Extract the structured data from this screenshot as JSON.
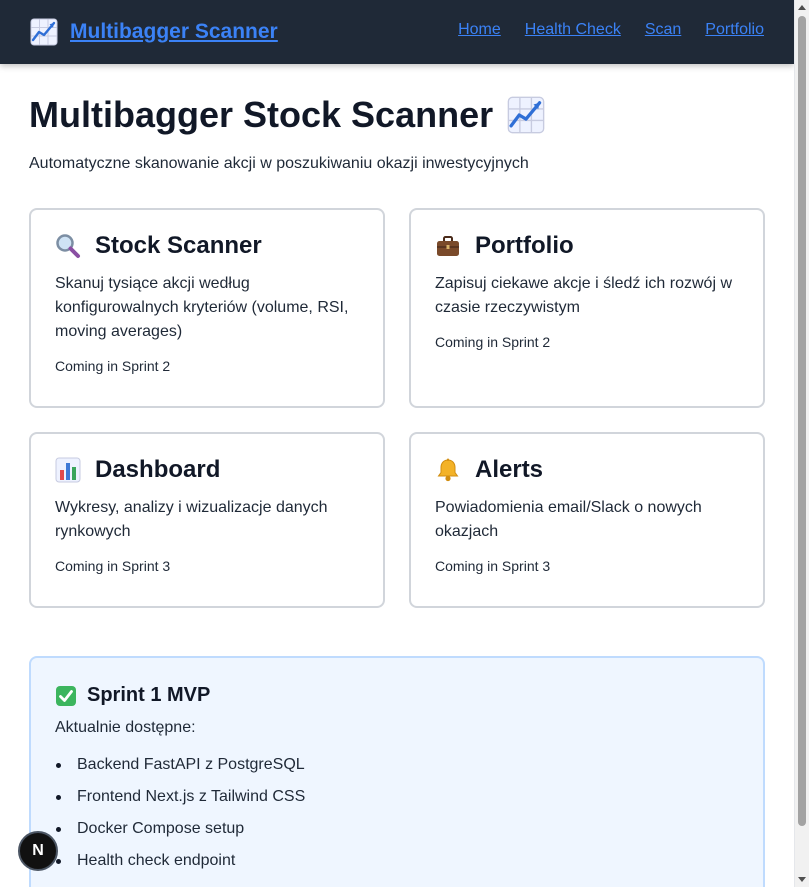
{
  "nav": {
    "brand": "Multibagger Scanner",
    "brand_icon": "chart-increasing-icon",
    "links": [
      "Home",
      "Health Check",
      "Scan",
      "Portfolio"
    ]
  },
  "header": {
    "title": "Multibagger Stock Scanner",
    "title_icon": "chart-increasing-icon",
    "subtitle": "Automatyczne skanowanie akcji w poszukiwaniu okazji inwestycyjnych"
  },
  "cards": [
    {
      "icon": "magnifying-glass-icon",
      "title": "Stock Scanner",
      "description": "Skanuj tysiące akcji według konfigurowalnych kryteriów (volume, RSI, moving averages)",
      "status": "Coming in Sprint 2"
    },
    {
      "icon": "briefcase-icon",
      "title": "Portfolio",
      "description": "Zapisuj ciekawe akcje i śledź ich rozwój w czasie rzeczywistym",
      "status": "Coming in Sprint 2"
    },
    {
      "icon": "bar-chart-icon",
      "title": "Dashboard",
      "description": "Wykresy, analizy i wizualizacje danych rynkowych",
      "status": "Coming in Sprint 3"
    },
    {
      "icon": "bell-icon",
      "title": "Alerts",
      "description": "Powiadomienia email/Slack o nowych okazjach",
      "status": "Coming in Sprint 3"
    }
  ],
  "mvp": {
    "icon": "check-mark-icon",
    "title": "Sprint 1 MVP",
    "subtitle": "Aktualnie dostępne:",
    "items": [
      "Backend FastAPI z PostgreSQL",
      "Frontend Next.js z Tailwind CSS",
      "Docker Compose setup",
      "Health check endpoint"
    ]
  },
  "badge": {
    "letter": "N"
  },
  "colors": {
    "navbar": "#1f2937",
    "link": "#3b82f6",
    "card_border": "#d1d5db",
    "mvp_bg": "#eff6ff",
    "mvp_border": "#bfdbfe"
  }
}
